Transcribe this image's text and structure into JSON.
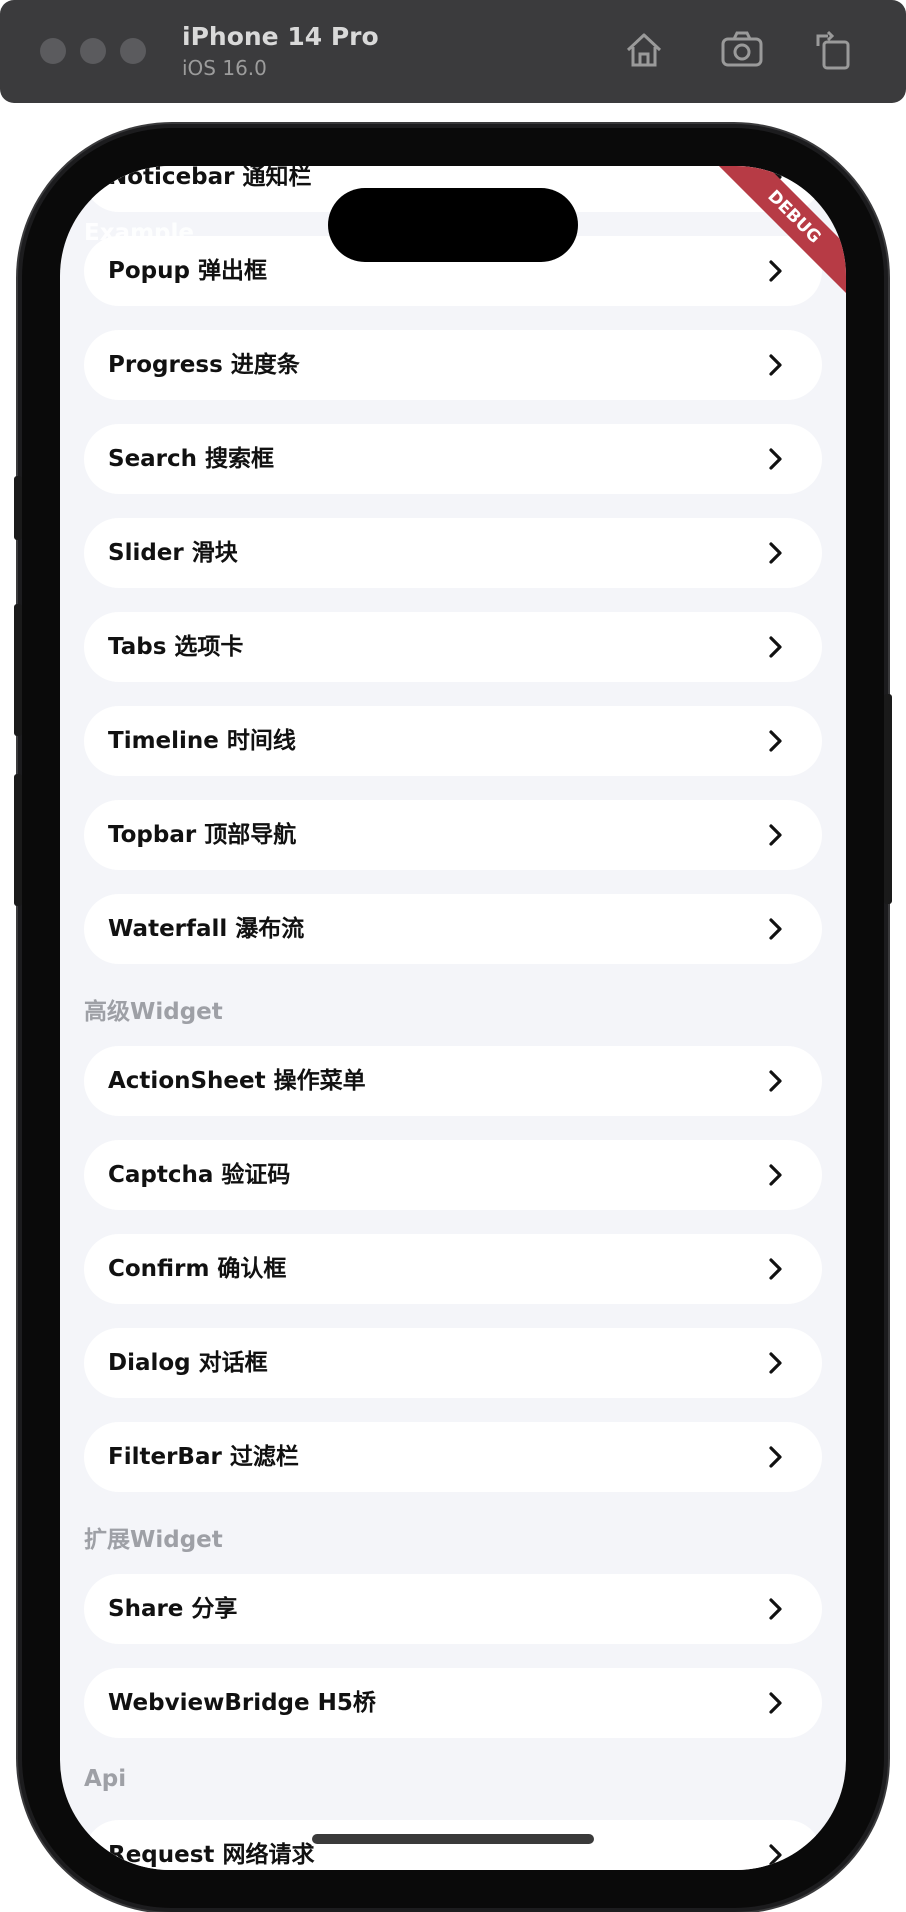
{
  "simulator": {
    "device_name": "iPhone 14 Pro",
    "os_version": "iOS 16.0",
    "icons": [
      "home-icon",
      "camera-icon",
      "rotate-icon"
    ]
  },
  "app": {
    "title": "Example",
    "debug_banner": "DEBUG"
  },
  "items_top": [
    {
      "label": "Noticebar 通知栏"
    },
    {
      "label": "Popup 弹出框"
    },
    {
      "label": "Progress 进度条"
    },
    {
      "label": "Search 搜索框"
    },
    {
      "label": "Slider 滑块"
    },
    {
      "label": "Tabs 选项卡"
    },
    {
      "label": "Timeline 时间线"
    },
    {
      "label": "Topbar 顶部导航"
    },
    {
      "label": "Waterfall 瀑布流"
    }
  ],
  "section_advanced": {
    "title": "高级Widget",
    "items": [
      {
        "label": "ActionSheet 操作菜单"
      },
      {
        "label": "Captcha 验证码"
      },
      {
        "label": "Confirm 确认框"
      },
      {
        "label": "Dialog 对话框"
      },
      {
        "label": "FilterBar 过滤栏"
      }
    ]
  },
  "section_extension": {
    "title": "扩展Widget",
    "items": [
      {
        "label": "Share 分享"
      },
      {
        "label": "WebviewBridge H5桥"
      }
    ]
  },
  "section_api": {
    "title": "Api",
    "items": [
      {
        "label": "Request 网络请求"
      }
    ]
  },
  "colors": {
    "accent": "#b73b45",
    "list_bg": "#f4f5f9",
    "section_title": "#9ea0a6"
  }
}
